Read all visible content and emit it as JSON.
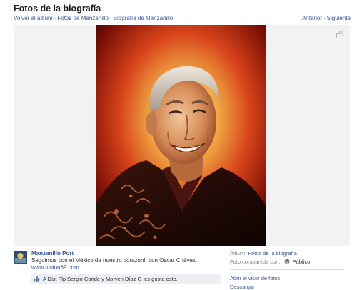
{
  "page": {
    "title": "Fotos de la biografía"
  },
  "breadcrumb": {
    "back": "Volver al álbum",
    "photos_of": "Fotos de Manzanillo",
    "bio": "Biografía de Manzanillo",
    "separator": "·"
  },
  "pager": {
    "previous": "Anterior",
    "next": "Siguiente",
    "separator": "·"
  },
  "photo": {
    "icon_expand": "expand-icon",
    "palette": {
      "bg_center": "#f4d37a",
      "bg_mid": "#e2571f",
      "bg_edge": "#5a0803",
      "skin": "#e0a06e",
      "hair": "#d8d0c8",
      "jacket": "#1a0806"
    }
  },
  "post": {
    "poster": "Manzanillo Port",
    "caption": "Seguimos con el México de nuestro corazon!! con Oscar Chávez.",
    "link": "www.fusion89.com",
    "likes_text": "A Dist Flp Sergio Conde y Morven Díaz G les gusta esto.",
    "likes_icon": "thumbs-up-icon"
  },
  "details": {
    "album_label": "Álbum:",
    "album_value": "Fotos de la biografía",
    "shared_label": "Foto compartida con:",
    "shared_icon": "globe-icon",
    "shared_value": "Público",
    "open_viewer": "Abrir el visor de fotos",
    "download": "Descargar"
  },
  "colors": {
    "link": "#3b5998",
    "likes_bg": "#edeff4",
    "stage_bg": "#f2f2f2"
  }
}
